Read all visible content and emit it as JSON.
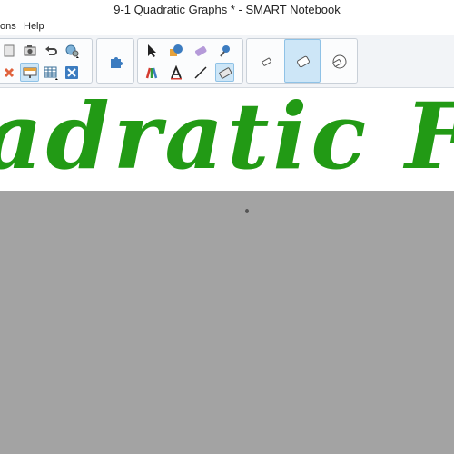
{
  "window": {
    "title": "9-1 Quadratic Graphs * - SMART Notebook"
  },
  "menu": {
    "items": [
      "ons",
      "Help"
    ]
  },
  "toolbar": {
    "group1": [
      "camera-icon",
      "undo-icon",
      "globe-settings-icon",
      "delete-icon",
      "screen-shade-icon",
      "table-icon",
      "close-box-icon",
      "page-icon"
    ],
    "group2": [
      "puzzle-addons-icon"
    ],
    "group3": [
      "select-arrow-icon",
      "shapes-icon",
      "eraser-pen-icon",
      "magic-pen-icon",
      "pens-icon",
      "text-icon",
      "line-icon",
      "eraser-icon"
    ],
    "group4": [
      "eraser-small-icon",
      "eraser-medium-icon",
      "eraser-large-icon"
    ],
    "active": [
      "screen-shade-icon",
      "eraser-icon",
      "eraser-medium-icon"
    ]
  },
  "banner": {
    "text": "adratic Func",
    "color": "#229a15"
  },
  "colors": {
    "canvas": "#a3a3a3",
    "active_button": "#cde6f7"
  }
}
